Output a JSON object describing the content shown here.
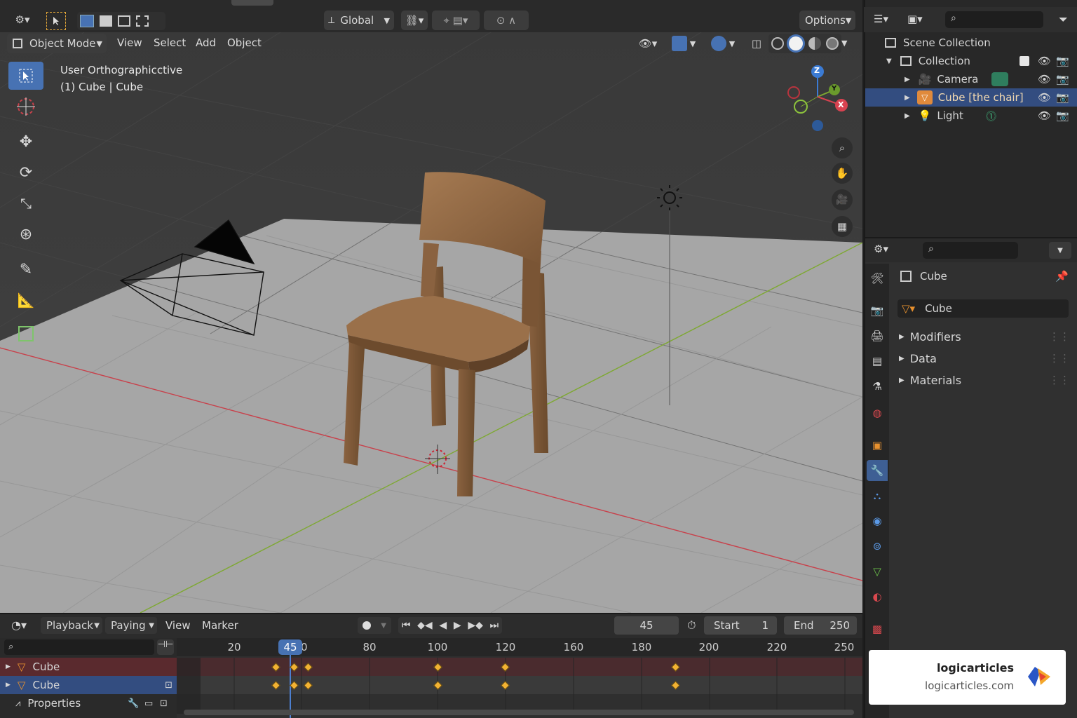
{
  "top_bar": {
    "transform_orientation": "Global",
    "options_label": "Options"
  },
  "viewport_header": {
    "mode": "Object Mode",
    "menus": [
      "View",
      "Select",
      "Add",
      "Object"
    ]
  },
  "viewport_overlay": {
    "line1": "User Orthographic",
    "line1_suffix": "ctive",
    "line2": "(1) Cube | Cube"
  },
  "gizmo": {
    "z": "Z",
    "y": "Y",
    "x": "X"
  },
  "outliner": {
    "root": "Scene Collection",
    "collection": "Collection",
    "items": [
      "Camera",
      "Cube [the chair]",
      "Light"
    ]
  },
  "properties": {
    "object_name": "Cube",
    "mesh_name": "Cube",
    "sections": [
      "Modifiers",
      "Data",
      "Materials"
    ]
  },
  "timeline_header": {
    "menus": [
      "Playback",
      "Paying",
      "View",
      "Marker"
    ],
    "current_frame": "45",
    "start_label": "Start",
    "start_value": "1",
    "end_label": "End",
    "end_value": "250"
  },
  "timeline": {
    "ticks": [
      "20",
      "80",
      "100",
      "120",
      "160",
      "180",
      "200",
      "220",
      "250"
    ],
    "current_frame_badge": "45",
    "badge_tail": "0",
    "channels": [
      "Cube",
      "Cube",
      "Properties"
    ]
  },
  "watermark": {
    "title": "logicarticles",
    "url": "logicarticles.com"
  },
  "colors": {
    "accent": "#4772b3",
    "keyframe": "#f2b233",
    "x_axis": "#c8414b",
    "y_axis": "#7ea832"
  }
}
